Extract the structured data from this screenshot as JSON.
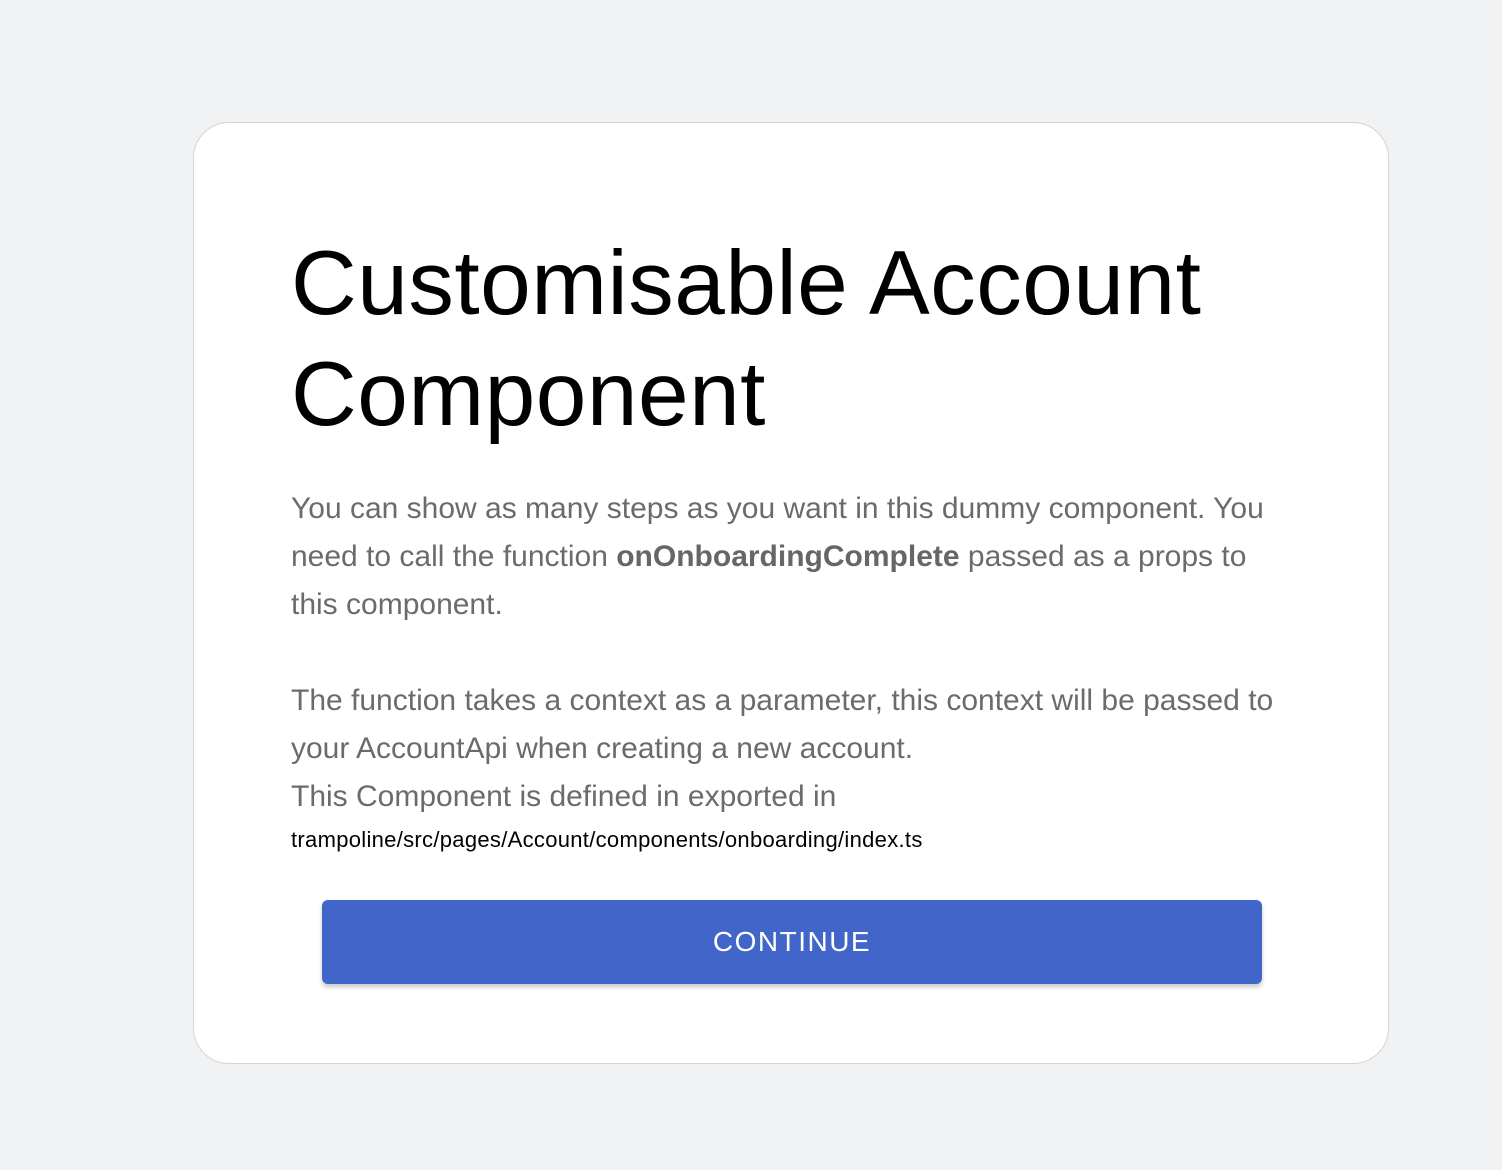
{
  "card": {
    "title": "Customisable Account Component",
    "paragraph1_before": "You can show as many steps as you want in this dummy component. You need to call the function ",
    "paragraph1_bold": "onOnboardingComplete",
    "paragraph1_after": " passed as a props to this component.",
    "paragraph2": "The function takes a context as a parameter, this context will be passed to your AccountApi when creating a new account.",
    "paragraph3": "This Component is defined in exported in",
    "file_path": "trampoline/src/pages/Account/components/onboarding/index.ts",
    "continue_label": "CONTINUE"
  },
  "colors": {
    "background": "#f1f2f4",
    "card": "#ffffff",
    "button": "#4165c8",
    "body_text": "#6b6b6b"
  }
}
